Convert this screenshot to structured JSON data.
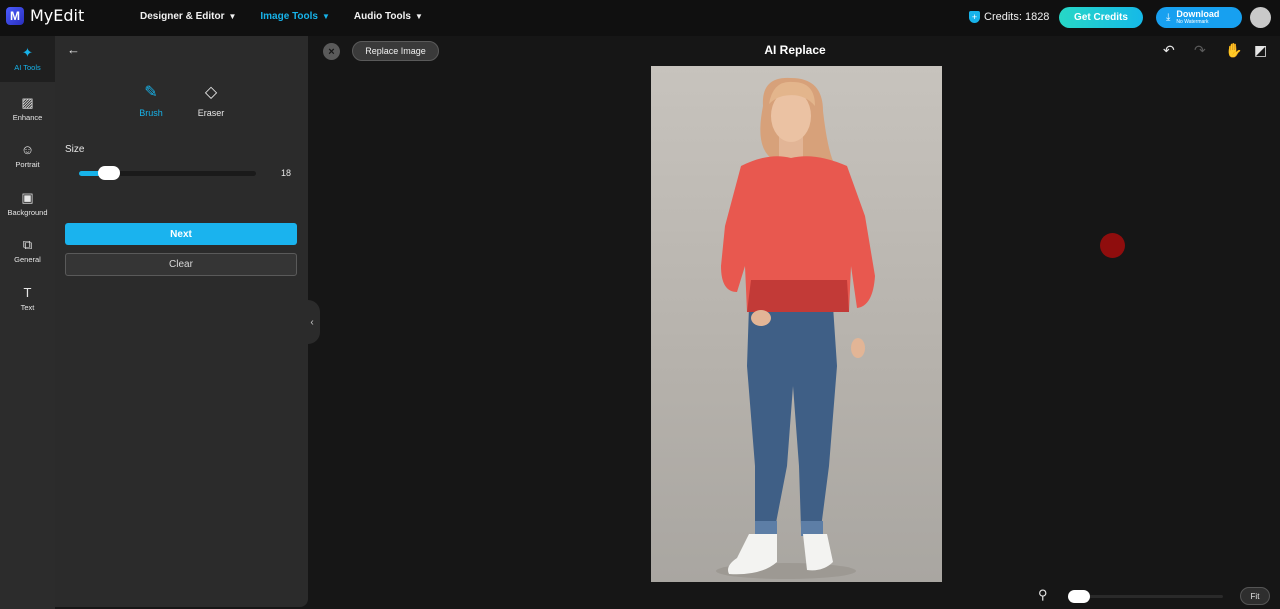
{
  "app": {
    "name": "MyEdit",
    "logo_letter": "M"
  },
  "nav": [
    {
      "label": "Designer & Editor",
      "active": false
    },
    {
      "label": "Image Tools",
      "active": true
    },
    {
      "label": "Audio Tools",
      "active": false
    }
  ],
  "header": {
    "credits_label": "Credits: 1828",
    "get_credits_label": "Get Credits",
    "download_label": "Download",
    "download_sub": "No Watermark"
  },
  "rail": [
    {
      "label": "AI Tools",
      "icon": "magic-wand-icon",
      "glyph": "✦",
      "active": true
    },
    {
      "label": "Enhance",
      "icon": "image-enhance-icon",
      "glyph": "▨",
      "active": false
    },
    {
      "label": "Portrait",
      "icon": "portrait-icon",
      "glyph": "☺",
      "active": false
    },
    {
      "label": "Background",
      "icon": "background-icon",
      "glyph": "▣",
      "active": false
    },
    {
      "label": "General",
      "icon": "general-icon",
      "glyph": "⧉",
      "active": false
    },
    {
      "label": "Text",
      "icon": "text-icon",
      "glyph": "T",
      "active": false
    }
  ],
  "panel": {
    "tools": [
      {
        "label": "Brush",
        "glyph": "✎",
        "active": true
      },
      {
        "label": "Eraser",
        "glyph": "◇",
        "active": false
      }
    ],
    "size_label": "Size",
    "size_value": "18",
    "size_fraction": 0.17,
    "next_label": "Next",
    "clear_label": "Clear"
  },
  "canvas": {
    "replace_label": "Replace Image",
    "title": "AI Replace",
    "fit_label": "Fit",
    "zoom_fraction": 0.07
  },
  "colors": {
    "accent": "#17b3ea",
    "brush_mask": "#e8584f",
    "brush_cursor": "#8f0d0d"
  }
}
